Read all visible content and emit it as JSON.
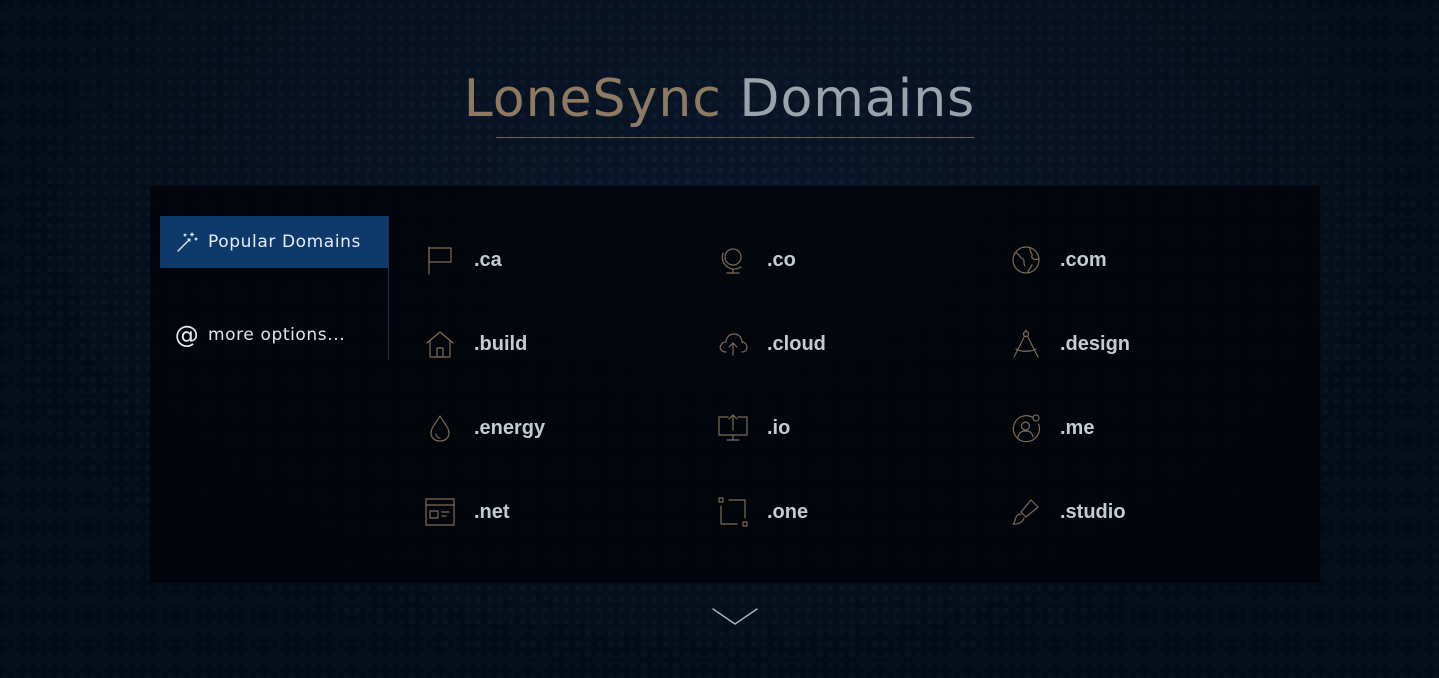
{
  "header": {
    "brand": "LoneSync",
    "word": "Domains"
  },
  "sidebar": {
    "tabs": [
      {
        "label": "Popular Domains",
        "icon": "magic-wand-icon",
        "active": true
      },
      {
        "label": "more options...",
        "icon": "at-sign-icon",
        "active": false
      }
    ]
  },
  "domains": [
    {
      "label": ".ca",
      "icon": "flag-icon"
    },
    {
      "label": ".co",
      "icon": "globe-stand-icon"
    },
    {
      "label": ".com",
      "icon": "earth-icon"
    },
    {
      "label": ".build",
      "icon": "house-icon"
    },
    {
      "label": ".cloud",
      "icon": "cloud-upload-icon"
    },
    {
      "label": ".design",
      "icon": "compass-drawing-icon"
    },
    {
      "label": ".energy",
      "icon": "water-drop-icon"
    },
    {
      "label": ".io",
      "icon": "monitor-upload-icon"
    },
    {
      "label": ".me",
      "icon": "user-circle-icon"
    },
    {
      "label": ".net",
      "icon": "browser-window-icon"
    },
    {
      "label": ".one",
      "icon": "crop-frame-icon"
    },
    {
      "label": ".studio",
      "icon": "paint-brush-icon"
    }
  ],
  "colors": {
    "accent": "#8e7a63",
    "active_tab": "#0d3a6a",
    "background": "#040c18"
  },
  "scroll_down_icon": "chevron-down-icon"
}
